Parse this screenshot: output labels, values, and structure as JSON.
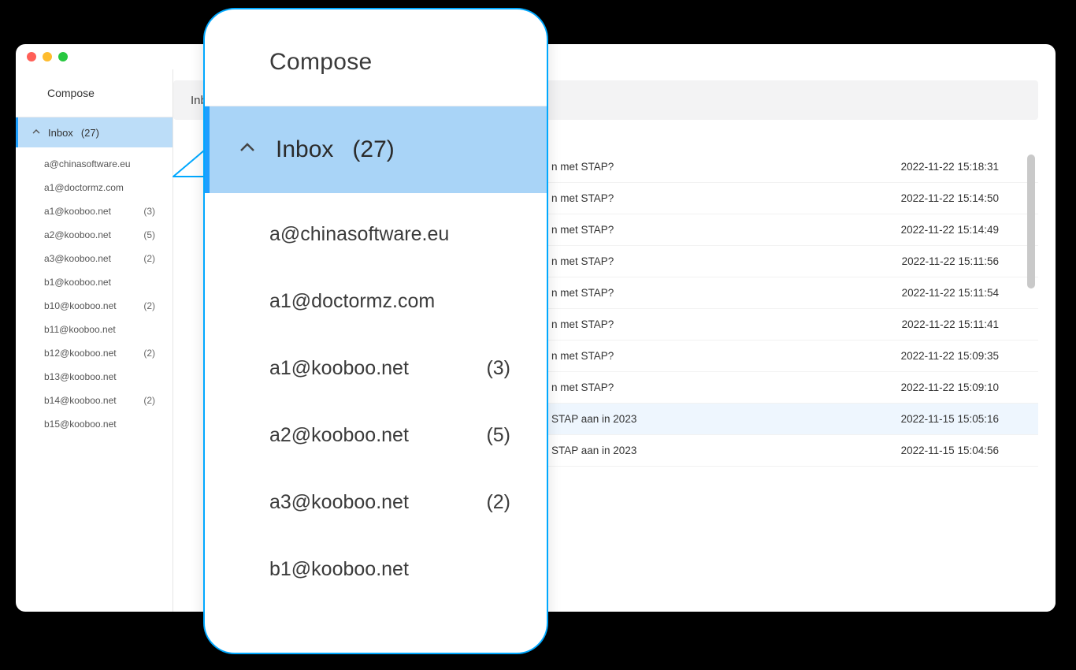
{
  "sidebar": {
    "compose_label": "Compose",
    "inbox_label": "Inbox",
    "inbox_count": "(27)",
    "accounts": [
      {
        "email": "a@chinasoftware.eu",
        "count": ""
      },
      {
        "email": "a1@doctormz.com",
        "count": ""
      },
      {
        "email": "a1@kooboo.net",
        "count": "(3)"
      },
      {
        "email": "a2@kooboo.net",
        "count": "(5)"
      },
      {
        "email": "a3@kooboo.net",
        "count": "(2)"
      },
      {
        "email": "b1@kooboo.net",
        "count": ""
      },
      {
        "email": "b10@kooboo.net",
        "count": "(2)"
      },
      {
        "email": "b11@kooboo.net",
        "count": ""
      },
      {
        "email": "b12@kooboo.net",
        "count": "(2)"
      },
      {
        "email": "b13@kooboo.net",
        "count": ""
      },
      {
        "email": "b14@kooboo.net",
        "count": "(2)"
      },
      {
        "email": "b15@kooboo.net",
        "count": ""
      }
    ]
  },
  "main": {
    "header_label": "Inb",
    "messages": [
      {
        "subject": "n met STAP?",
        "date": "2022-11-22 15:18:31",
        "highlight": false
      },
      {
        "subject": "n met STAP?",
        "date": "2022-11-22 15:14:50",
        "highlight": false
      },
      {
        "subject": "n met STAP?",
        "date": "2022-11-22 15:14:49",
        "highlight": false
      },
      {
        "subject": "n met STAP?",
        "date": "2022-11-22 15:11:56",
        "highlight": false
      },
      {
        "subject": "n met STAP?",
        "date": "2022-11-22 15:11:54",
        "highlight": false
      },
      {
        "subject": "n met STAP?",
        "date": "2022-11-22 15:11:41",
        "highlight": false
      },
      {
        "subject": "n met STAP?",
        "date": "2022-11-22 15:09:35",
        "highlight": false
      },
      {
        "subject": "n met STAP?",
        "date": "2022-11-22 15:09:10",
        "highlight": false
      },
      {
        "subject": "STAP aan in 2023",
        "date": "2022-11-15 15:05:16",
        "highlight": true
      },
      {
        "subject": "STAP aan in 2023",
        "date": "2022-11-15 15:04:56",
        "highlight": false
      }
    ]
  },
  "callout": {
    "compose_label": "Compose",
    "inbox_label": "Inbox",
    "inbox_count": "(27)",
    "accounts": [
      {
        "email": "a@chinasoftware.eu",
        "count": ""
      },
      {
        "email": "a1@doctormz.com",
        "count": ""
      },
      {
        "email": "a1@kooboo.net",
        "count": "(3)"
      },
      {
        "email": "a2@kooboo.net",
        "count": "(5)"
      },
      {
        "email": "a3@kooboo.net",
        "count": "(2)"
      },
      {
        "email": "b1@kooboo.net",
        "count": ""
      }
    ]
  }
}
